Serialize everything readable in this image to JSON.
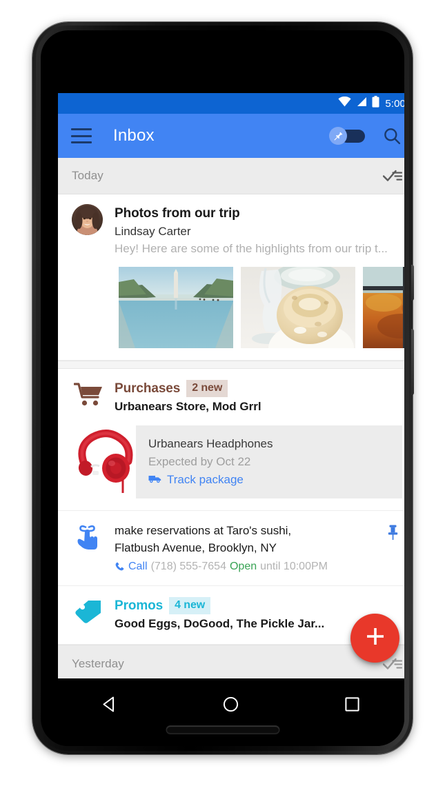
{
  "status_bar": {
    "time": "5:00",
    "icons": [
      "wifi-icon",
      "signal-icon",
      "battery-icon"
    ],
    "background": "#0d64d2"
  },
  "app_bar": {
    "title": "Inbox",
    "menu_icon": "hamburger-menu-icon",
    "pin_toggle_icon": "pin-icon",
    "pin_toggle_state": "off",
    "search_icon": "search-icon",
    "background": "#4184f3"
  },
  "sections": [
    {
      "label": "Today",
      "sweep_icon": "sweep-done-icon"
    },
    {
      "label": "Yesterday",
      "sweep_icon": "sweep-done-icon"
    }
  ],
  "items": {
    "photos": {
      "avatar": "contact-avatar-photo",
      "subject": "Photos from our trip",
      "sender": "Lindsay Carter",
      "snippet": "Hey! Here are some of the highlights from our trip t...",
      "attachments": [
        {
          "name": "washington-monument-reflecting-pool-photo"
        },
        {
          "name": "dessert-on-plate-photo"
        },
        {
          "name": "autumn-window-view-photo"
        }
      ]
    },
    "purchases": {
      "icon": "shopping-cart-icon",
      "title": "Purchases",
      "badge": "2 new",
      "senders": "Urbanears Store, Mod Grrl",
      "accent": "#7a4a3a",
      "badge_bg": "#e4d8d3",
      "detail": {
        "image": "red-headphones-photo",
        "product": "Urbanears Headphones",
        "eta": "Expected by Oct 22",
        "track_icon": "delivery-truck-icon",
        "track_label": "Track package",
        "track_color": "#4184f3",
        "card_bg": "#ececec"
      }
    },
    "reminder": {
      "icon": "reminder-finger-string-icon",
      "line1": "make reservations at Taro's sushi,",
      "line2": "Flatbush Avenue, Brooklyn, NY",
      "call_icon": "phone-icon",
      "call_label": "Call",
      "phone_number": "(718) 555-7654",
      "open_status": "Open",
      "hours": "until 10:00PM",
      "pinned_icon": "pushpin-icon",
      "open_color": "#38a354"
    },
    "promos": {
      "icon": "price-tag-icon",
      "title": "Promos",
      "badge": "4 new",
      "senders": "Good Eggs, DoGood, The Pickle Jar...",
      "accent": "#1bb6d6",
      "badge_bg": "#d6f0f7"
    }
  },
  "fab": {
    "icon": "plus-icon",
    "label": "Compose",
    "color": "#e8382a"
  },
  "nav_bar": {
    "back_icon": "back-triangle-icon",
    "home_icon": "home-circle-icon",
    "recents_icon": "recents-square-icon"
  }
}
